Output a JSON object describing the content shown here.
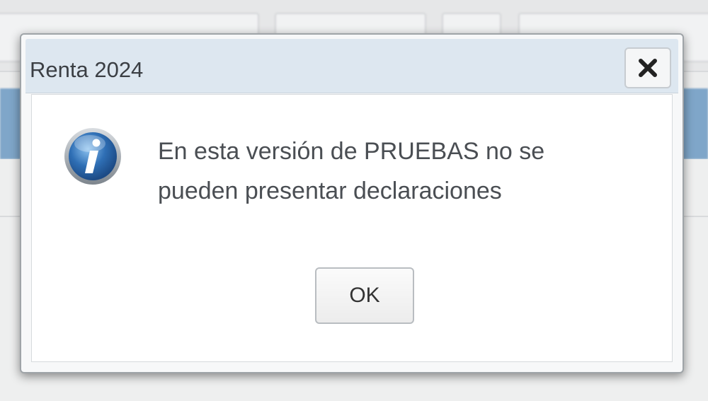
{
  "dialog": {
    "title": "Renta 2024",
    "message_line1": "En esta versión de PRUEBAS no se",
    "message_line2": "pueden presentar declaraciones",
    "ok_label": "OK",
    "icon": "info-icon",
    "close_icon": "close-icon"
  },
  "colors": {
    "titlebar": "#dde7f0",
    "info_blue": "#2f6fb5",
    "background_stripe": "#7fa6c9"
  }
}
